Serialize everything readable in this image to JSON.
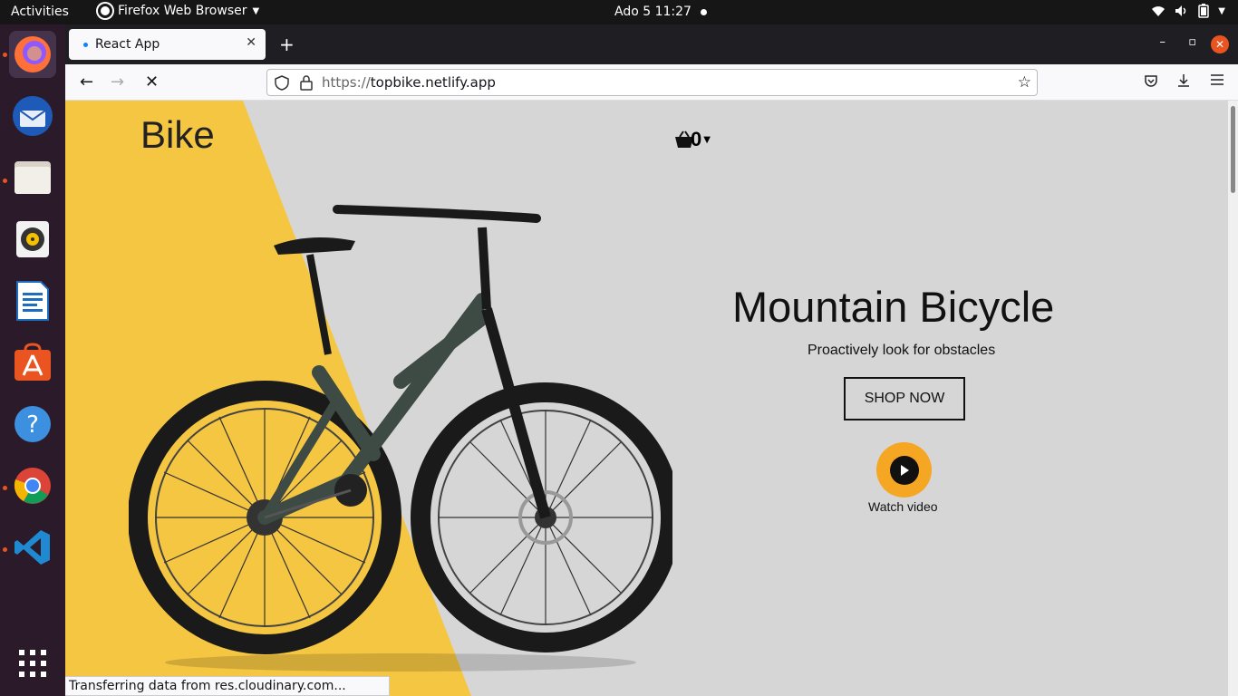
{
  "topbar": {
    "activities": "Activities",
    "app_name": "Firefox Web Browser",
    "clock": "Ado 5  11:27"
  },
  "dock": {
    "items": [
      {
        "name": "firefox-icon",
        "running": true
      },
      {
        "name": "thunderbird-icon",
        "running": false
      },
      {
        "name": "files-icon",
        "running": true
      },
      {
        "name": "rhythmbox-icon",
        "running": false
      },
      {
        "name": "libreoffice-writer-icon",
        "running": false
      },
      {
        "name": "ubuntu-software-icon",
        "running": false
      },
      {
        "name": "help-icon",
        "running": false
      },
      {
        "name": "chrome-icon",
        "running": true
      },
      {
        "name": "vscode-icon",
        "running": true
      }
    ],
    "apps_grid": "show-applications-icon"
  },
  "browser": {
    "tab_title": "React App",
    "url_scheme": "https://",
    "url_host": "topbike.netlify.app",
    "status_text": "Transferring data from res.cloudinary.com..."
  },
  "page": {
    "logo": "Bike",
    "cart_count": "0",
    "hero_title": "Mountain Bicycle",
    "hero_subtitle": "Proactively look for obstacles",
    "shop_button": "SHOP NOW",
    "watch_label": "Watch video",
    "colors": {
      "accent_yellow": "#f5c642",
      "page_bg": "#d6d6d6",
      "play_orange": "#f5a623"
    }
  }
}
